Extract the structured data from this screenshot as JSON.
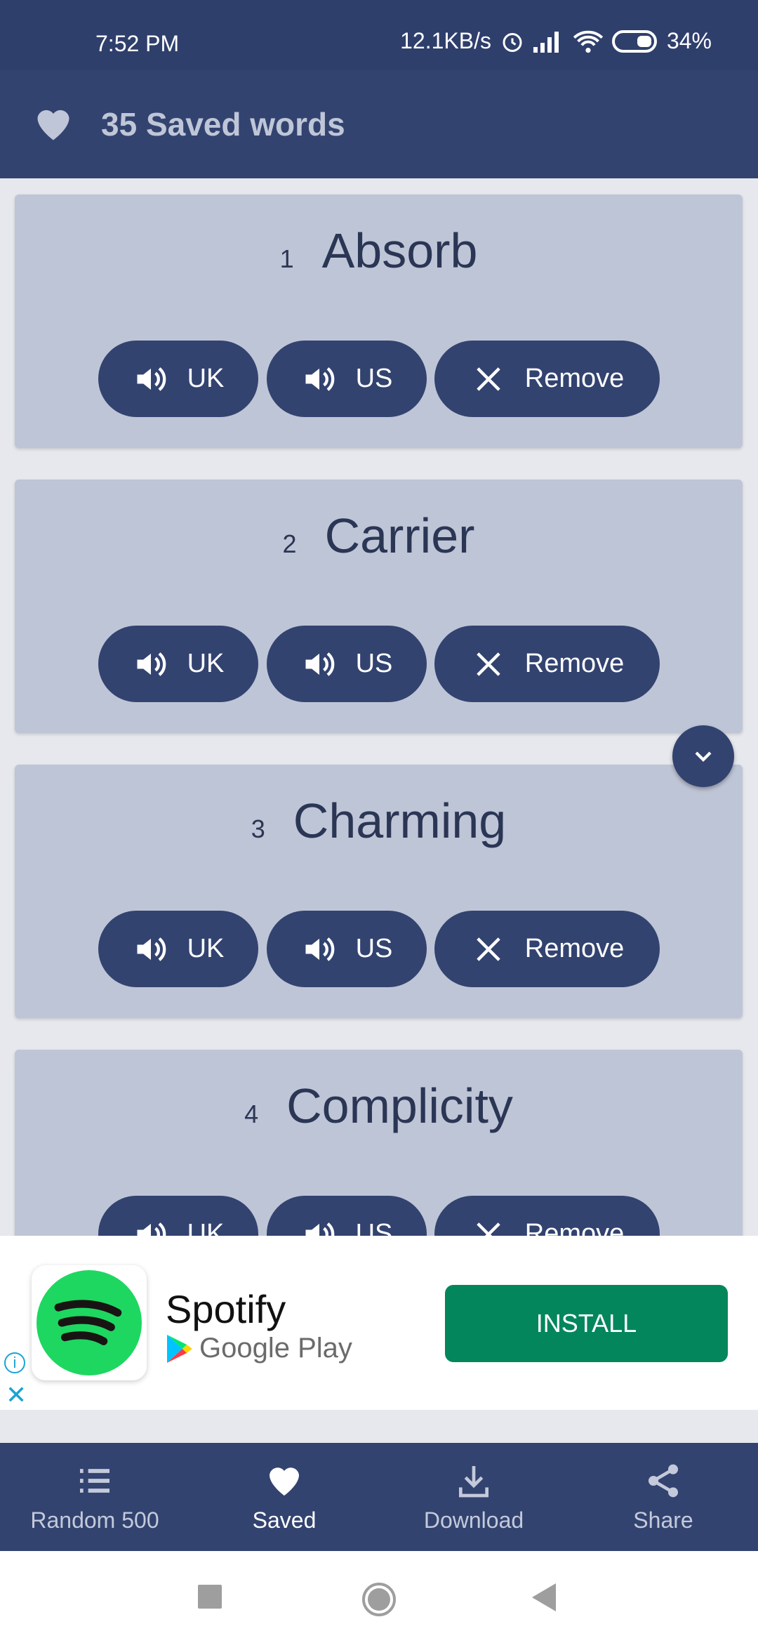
{
  "status_bar": {
    "time": "7:52 PM",
    "speed": "12.1KB/s",
    "battery": "34%"
  },
  "header": {
    "icon": "heart-icon",
    "title": "35 Saved words"
  },
  "words": [
    {
      "num": "1",
      "word": "Absorb"
    },
    {
      "num": "2",
      "word": "Carrier"
    },
    {
      "num": "3",
      "word": "Charming"
    },
    {
      "num": "4",
      "word": "Complicity"
    }
  ],
  "buttons": {
    "uk": "UK",
    "us": "US",
    "remove": "Remove"
  },
  "ad": {
    "app_name": "Spotify",
    "store": "Google Play",
    "install": "INSTALL",
    "info": "i",
    "close": "✕"
  },
  "bottom_nav": [
    {
      "label": "Random 500",
      "icon": "list-icon"
    },
    {
      "label": "Saved",
      "icon": "heart-icon",
      "active": true
    },
    {
      "label": "Download",
      "icon": "download-icon"
    },
    {
      "label": "Share",
      "icon": "share-icon"
    }
  ],
  "colors": {
    "primary": "#334370",
    "card": "#bec5d6",
    "install": "#03865c"
  }
}
